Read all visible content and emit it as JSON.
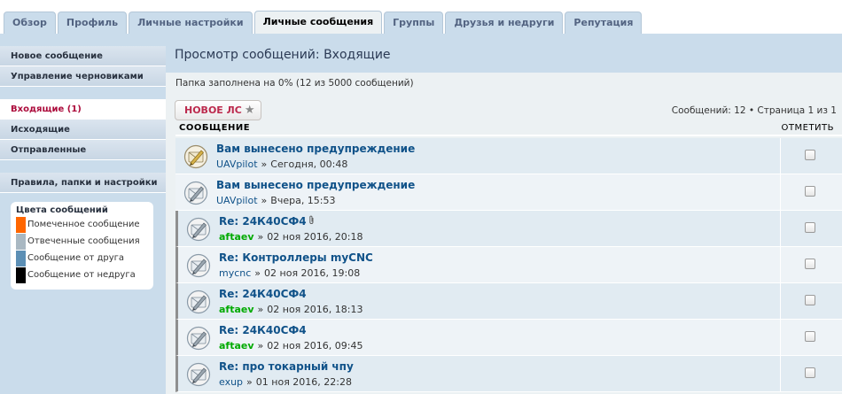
{
  "tabs": [
    {
      "label": "Обзор",
      "active": false
    },
    {
      "label": "Профиль",
      "active": false
    },
    {
      "label": "Личные настройки",
      "active": false
    },
    {
      "label": "Личные сообщения",
      "active": true
    },
    {
      "label": "Группы",
      "active": false
    },
    {
      "label": "Друзья и недруги",
      "active": false
    },
    {
      "label": "Репутация",
      "active": false
    }
  ],
  "page_title": "Просмотр сообщений: Входящие",
  "sidebar": {
    "top_items": [
      {
        "label": "Новое сообщение"
      },
      {
        "label": "Управление черновиками"
      }
    ],
    "folders": [
      {
        "label": "Входящие (1)",
        "active": true
      },
      {
        "label": "Исходящие",
        "active": false
      },
      {
        "label": "Отправленные",
        "active": false
      }
    ],
    "settings_item": {
      "label": "Правила, папки и настройки"
    },
    "colors_title": "Цвета сообщений",
    "legend": [
      {
        "label": "Помеченное сообщение",
        "color": "#ff6600"
      },
      {
        "label": "Отвеченные сообщения",
        "color": "#a9b8c2"
      },
      {
        "label": "Сообщение от друга",
        "color": "#5c8fb5"
      },
      {
        "label": "Сообщение от недруга",
        "color": "#000000"
      }
    ]
  },
  "main": {
    "folder_status": "Папка заполнена на 0% (12 из 5000 сообщений)",
    "new_pm_button": "НОВОЕ ЛС",
    "pagination_info": "Сообщений: 12 • Страница 1 из 1",
    "header_message": "СООБЩЕНИЕ",
    "header_mark": "ОТМЕТИТЬ",
    "messages": [
      {
        "subject": "Вам вынесено предупреждение",
        "author": "UAVpilot",
        "sep": "»",
        "date": "Сегодня, 00:48",
        "author_green": false,
        "unread": true,
        "attachment": false
      },
      {
        "subject": "Вам вынесено предупреждение",
        "author": "UAVpilot",
        "sep": "»",
        "date": "Вчера, 15:53",
        "author_green": false,
        "unread": false,
        "attachment": false
      },
      {
        "subject": "Re: 24К40СФ4",
        "author": "aftaev",
        "sep": "»",
        "date": "02 ноя 2016, 20:18",
        "author_green": true,
        "unread": false,
        "attachment": true
      },
      {
        "subject": "Re: Контроллеры myCNC",
        "author": "mycnc",
        "sep": "»",
        "date": "02 ноя 2016, 19:08",
        "author_green": false,
        "unread": false,
        "attachment": false
      },
      {
        "subject": "Re: 24К40СФ4",
        "author": "aftaev",
        "sep": "»",
        "date": "02 ноя 2016, 18:13",
        "author_green": true,
        "unread": false,
        "attachment": false
      },
      {
        "subject": "Re: 24К40СФ4",
        "author": "aftaev",
        "sep": "»",
        "date": "02 ноя 2016, 09:45",
        "author_green": true,
        "unread": false,
        "attachment": false
      },
      {
        "subject": "Re: про токарный чпу",
        "author": "exup",
        "sep": "»",
        "date": "01 ноя 2016, 22:28",
        "author_green": false,
        "unread": false,
        "attachment": false
      }
    ]
  },
  "icons": {
    "message_icon": "envelope-pencil-icon",
    "attachment_icon": "paperclip-icon"
  }
}
